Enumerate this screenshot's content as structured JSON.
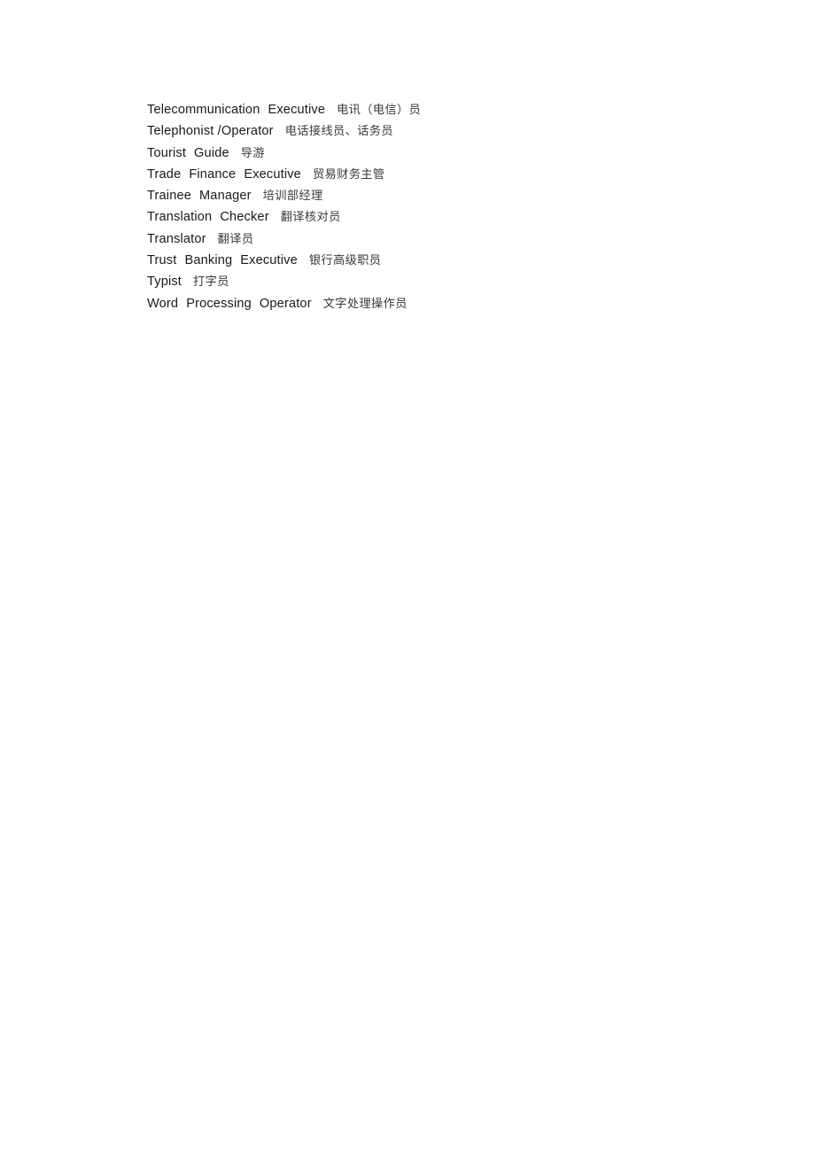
{
  "document": {
    "background_color": "#ffffff",
    "text_color": "#1a1a1a",
    "zh_text_color": "#3a3a3a",
    "entries": [
      {
        "en_words": [
          "Telecommunication",
          "Executive"
        ],
        "zh": "电讯（电信）员"
      },
      {
        "en_words": [
          "Telephonist /Operator"
        ],
        "zh": "电话接线员、话务员"
      },
      {
        "en_words": [
          "Tourist",
          "Guide"
        ],
        "zh": "导游"
      },
      {
        "en_words": [
          "Trade",
          "Finance",
          "Executive"
        ],
        "zh": "贸易财务主管"
      },
      {
        "en_words": [
          "Trainee",
          "Manager"
        ],
        "zh": "培训部经理"
      },
      {
        "en_words": [
          "Translation",
          "Checker"
        ],
        "zh": "翻译核对员"
      },
      {
        "en_words": [
          "Translator"
        ],
        "zh": "翻译员"
      },
      {
        "en_words": [
          "Trust",
          "Banking",
          "Executive"
        ],
        "zh": "银行高级职员"
      },
      {
        "en_words": [
          "Typist"
        ],
        "zh": "打字员"
      },
      {
        "en_words": [
          "Word",
          "Processing",
          "Operator"
        ],
        "zh": "文字处理操作员"
      }
    ]
  }
}
